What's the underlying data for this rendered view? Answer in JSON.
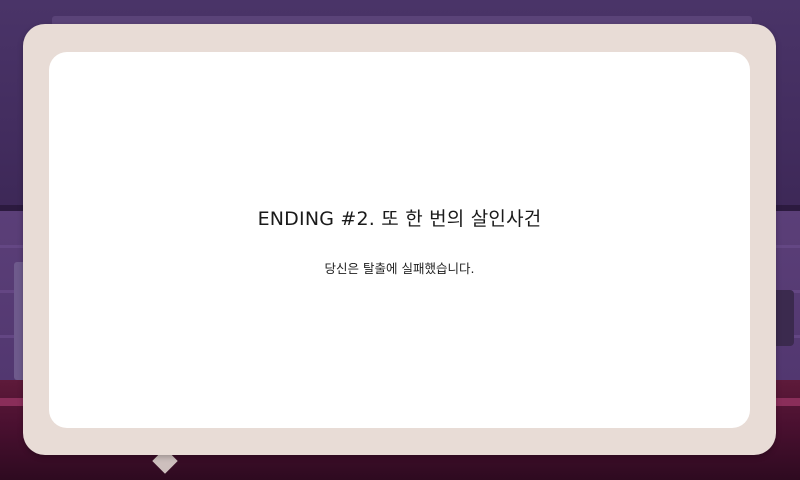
{
  "ending_dialog": {
    "title": "ENDING #2. 또 한 번의 살인사건",
    "message": "당신은 탈출에 실패했습니다."
  },
  "colors": {
    "dialog_border": "#e8dcd6",
    "dialog_fill": "#ffffff",
    "text": "#1a1a1a",
    "background_wall": "#4a3468",
    "background_floor": "#5e1a3a"
  }
}
